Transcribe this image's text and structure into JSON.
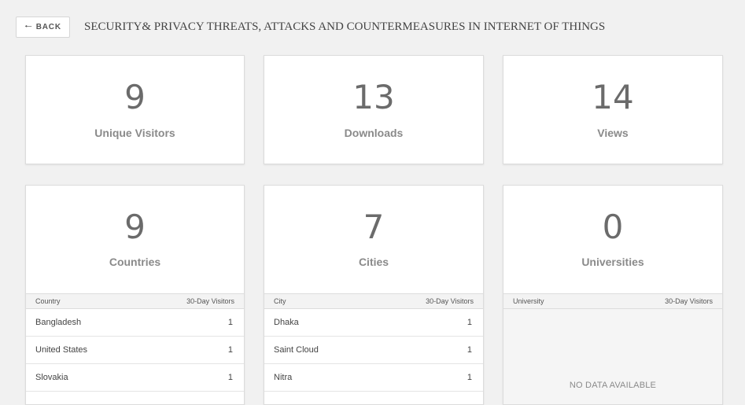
{
  "header": {
    "back_label": "BACK",
    "back_icon": "arrow-left-icon",
    "title": "SECURITY& PRIVACY THREATS, ATTACKS AND COUNTERMEASURES IN INTERNET OF THINGS"
  },
  "stats": {
    "unique_visitors": {
      "value": "9",
      "label": "Unique Visitors"
    },
    "downloads": {
      "value": "13",
      "label": "Downloads"
    },
    "views": {
      "value": "14",
      "label": "Views"
    }
  },
  "countries": {
    "value": "9",
    "label": "Countries",
    "col1": "Country",
    "col2": "30-Day Visitors",
    "rows": [
      {
        "name": "Bangladesh",
        "count": "1"
      },
      {
        "name": "United States",
        "count": "1"
      },
      {
        "name": "Slovakia",
        "count": "1"
      }
    ]
  },
  "cities": {
    "value": "7",
    "label": "Cities",
    "col1": "City",
    "col2": "30-Day Visitors",
    "rows": [
      {
        "name": "Dhaka",
        "count": "1"
      },
      {
        "name": "Saint Cloud",
        "count": "1"
      },
      {
        "name": "Nitra",
        "count": "1"
      }
    ]
  },
  "universities": {
    "value": "0",
    "label": "Universities",
    "col1": "University",
    "col2": "30-Day Visitors",
    "empty_text": "NO DATA AVAILABLE"
  }
}
